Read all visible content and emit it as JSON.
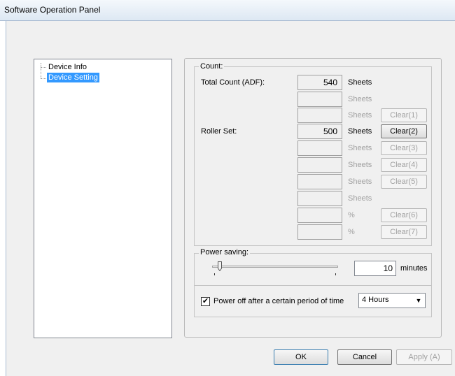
{
  "window": {
    "title": "Software Operation Panel"
  },
  "tree": {
    "items": [
      {
        "label": "Device Info",
        "selected": false
      },
      {
        "label": "Device Setting",
        "selected": true
      }
    ]
  },
  "count": {
    "legend": "Count:",
    "rows": [
      {
        "label": "Total Count (ADF):",
        "value": "540",
        "unit": "Sheets",
        "enabled": true,
        "clear": ""
      },
      {
        "label": "",
        "value": "",
        "unit": "Sheets",
        "enabled": false,
        "clear": ""
      },
      {
        "label": "",
        "value": "",
        "unit": "Sheets",
        "enabled": false,
        "clear": "Clear(1)",
        "clear_enabled": false
      },
      {
        "label": "Roller Set:",
        "value": "500",
        "unit": "Sheets",
        "enabled": true,
        "clear": "Clear(2)",
        "clear_enabled": true
      },
      {
        "label": "",
        "value": "",
        "unit": "Sheets",
        "enabled": false,
        "clear": "Clear(3)",
        "clear_enabled": false
      },
      {
        "label": "",
        "value": "",
        "unit": "Sheets",
        "enabled": false,
        "clear": "Clear(4)",
        "clear_enabled": false
      },
      {
        "label": "",
        "value": "",
        "unit": "Sheets",
        "enabled": false,
        "clear": "Clear(5)",
        "clear_enabled": false
      },
      {
        "label": "",
        "value": "",
        "unit": "Sheets",
        "enabled": false,
        "clear": ""
      },
      {
        "label": "",
        "value": "",
        "unit": "%",
        "enabled": false,
        "clear": "Clear(6)",
        "clear_enabled": false
      },
      {
        "label": "",
        "value": "",
        "unit": "%",
        "enabled": false,
        "clear": "Clear(7)",
        "clear_enabled": false
      }
    ]
  },
  "power": {
    "legend": "Power saving:",
    "minutes": "10",
    "minutes_label": "minutes",
    "power_off_label": "Power off after a certain period of time",
    "power_off_checked": true,
    "power_off_value": "4 Hours"
  },
  "footer": {
    "ok": "OK",
    "cancel": "Cancel",
    "apply": "Apply (A)"
  }
}
